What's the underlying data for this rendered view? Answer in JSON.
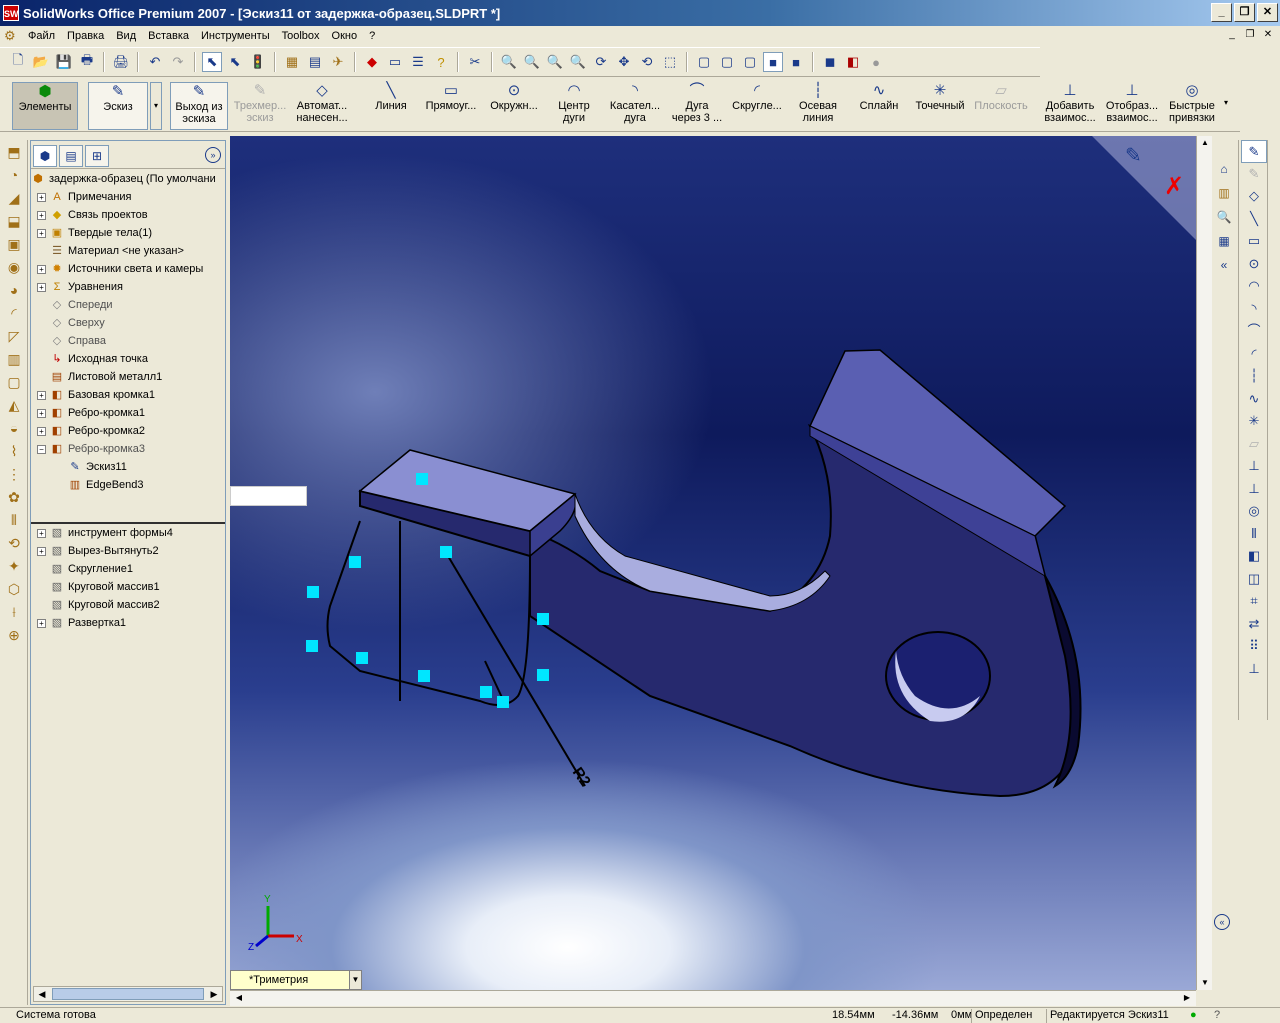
{
  "window": {
    "title": "SolidWorks Office Premium 2007 - [Эскиз11 от задержка-образец.SLDPRT *]",
    "app_icon": "SW",
    "buttons": [
      "_",
      "❐",
      "✕"
    ]
  },
  "menu": {
    "items": [
      "Файл",
      "Правка",
      "Вид",
      "Вставка",
      "Инструменты",
      "Toolbox",
      "Окно",
      "?"
    ],
    "doc_buttons": [
      "_",
      "❐",
      "✕"
    ]
  },
  "command_manager": {
    "items": [
      {
        "label": "Элементы",
        "icon": "features-icon",
        "state": "active"
      },
      {
        "label": "Эскиз",
        "icon": "sketch-icon",
        "state": "boxed"
      },
      {
        "label1": "Выход из",
        "label2": "эскиза",
        "icon": "exit-sketch-icon",
        "state": "boxed"
      },
      {
        "label1": "Трехмер...",
        "label2": "эскиз",
        "icon": "3d-sketch-icon",
        "state": "disabled"
      },
      {
        "label1": "Автомат...",
        "label2": "нанесен...",
        "icon": "smart-dimension-icon",
        "state": "normal"
      },
      {
        "label": "Линия",
        "icon": "line-icon",
        "state": "normal"
      },
      {
        "label": "Прямоуг...",
        "icon": "rectangle-icon",
        "state": "normal"
      },
      {
        "label": "Окружн...",
        "icon": "circle-icon",
        "state": "normal"
      },
      {
        "label1": "Центр",
        "label2": "дуги",
        "icon": "center-arc-icon",
        "state": "normal"
      },
      {
        "label1": "Касател...",
        "label2": "дуга",
        "icon": "tangent-arc-icon",
        "state": "normal"
      },
      {
        "label1": "Дуга",
        "label2": "через 3 ...",
        "icon": "three-point-arc-icon",
        "state": "normal"
      },
      {
        "label": "Скругле...",
        "icon": "fillet-icon",
        "state": "normal"
      },
      {
        "label1": "Осевая",
        "label2": "линия",
        "icon": "centerline-icon",
        "state": "normal"
      },
      {
        "label": "Сплайн",
        "icon": "spline-icon",
        "state": "normal"
      },
      {
        "label": "Точечный",
        "icon": "point-icon",
        "state": "normal"
      },
      {
        "label": "Плоскость",
        "icon": "plane-icon",
        "state": "disabled"
      },
      {
        "label1": "Добавить",
        "label2": "взаимос...",
        "icon": "add-relation-icon",
        "state": "normal"
      },
      {
        "label1": "Отобраз...",
        "label2": "взаимос...",
        "icon": "display-relations-icon",
        "state": "normal"
      },
      {
        "label1": "Быстрые",
        "label2": "привязки",
        "icon": "quick-snaps-icon",
        "state": "normal"
      }
    ]
  },
  "feature_tree": {
    "root": "задержка-образец  (По умолчани",
    "nodes": [
      {
        "label": "Примечания",
        "expand": "+",
        "icon": "A",
        "color": "#c07000",
        "indent": 0
      },
      {
        "label": "Связь проектов",
        "expand": "+",
        "icon": "◆",
        "color": "#d0a000",
        "indent": 0
      },
      {
        "label": "Твердые тела(1)",
        "expand": "+",
        "icon": "▣",
        "color": "#c08000",
        "indent": 0
      },
      {
        "label": "Материал <не указан>",
        "expand": "",
        "icon": "☰",
        "color": "#806030",
        "indent": 0
      },
      {
        "label": "Источники света и камеры",
        "expand": "+",
        "icon": "✹",
        "color": "#d08000",
        "indent": 0
      },
      {
        "label": "Уравнения",
        "expand": "+",
        "icon": "Σ",
        "color": "#c08000",
        "indent": 0
      },
      {
        "label": "Спереди",
        "expand": "",
        "icon": "◇",
        "color": "#808080",
        "indent": 0,
        "gray": true
      },
      {
        "label": "Сверху",
        "expand": "",
        "icon": "◇",
        "color": "#808080",
        "indent": 0,
        "gray": true
      },
      {
        "label": "Справа",
        "expand": "",
        "icon": "◇",
        "color": "#808080",
        "indent": 0,
        "gray": true
      },
      {
        "label": "Исходная точка",
        "expand": "",
        "icon": "↳",
        "color": "#c00000",
        "indent": 0
      },
      {
        "label": "Листовой металл1",
        "expand": "",
        "icon": "▤",
        "color": "#a04000",
        "indent": 0
      },
      {
        "label": "Базовая кромка1",
        "expand": "+",
        "icon": "◧",
        "color": "#a04000",
        "indent": 0
      },
      {
        "label": "Ребро-кромка1",
        "expand": "+",
        "icon": "◧",
        "color": "#a04000",
        "indent": 0
      },
      {
        "label": "Ребро-кромка2",
        "expand": "+",
        "icon": "◧",
        "color": "#a04000",
        "indent": 0
      },
      {
        "label": "Ребро-кромка3",
        "expand": "−",
        "icon": "◧",
        "color": "#a04000",
        "indent": 0,
        "gray": true
      },
      {
        "label": "Эскиз11",
        "expand": "",
        "icon": "✎",
        "color": "#1a3a8a",
        "indent": 1
      },
      {
        "label": "EdgeBend3",
        "expand": "",
        "icon": "▥",
        "color": "#a04000",
        "indent": 1
      }
    ],
    "suppressed_nodes": [
      {
        "label": "инструмент формы4",
        "expand": "+",
        "icon": "▧",
        "color": "#606060"
      },
      {
        "label": "Вырез-Вытянуть2",
        "expand": "+",
        "icon": "▧",
        "color": "#606060"
      },
      {
        "label": "Скругление1",
        "expand": "",
        "icon": "▧",
        "color": "#606060"
      },
      {
        "label": "Круговой массив1",
        "expand": "",
        "icon": "▧",
        "color": "#606060"
      },
      {
        "label": "Круговой массив2",
        "expand": "",
        "icon": "▧",
        "color": "#606060"
      },
      {
        "label": "Развертка1",
        "expand": "+",
        "icon": "▧",
        "color": "#606060"
      }
    ]
  },
  "graphics": {
    "view_orientation": "*Триметрия",
    "dimension_label": "R2",
    "axis_labels": {
      "x": "X",
      "y": "Y",
      "z": "Z"
    }
  },
  "status_bar": {
    "message": "Система готова",
    "x": "18.54мм",
    "y": "-14.36мм",
    "z": "0мм",
    "state": "Определен",
    "editing": "Редактируется Эскиз11"
  },
  "colors": {
    "part_face": "#2b2f7a",
    "part_top": "#7b82c8",
    "relation_marker": "#00e6ff"
  }
}
